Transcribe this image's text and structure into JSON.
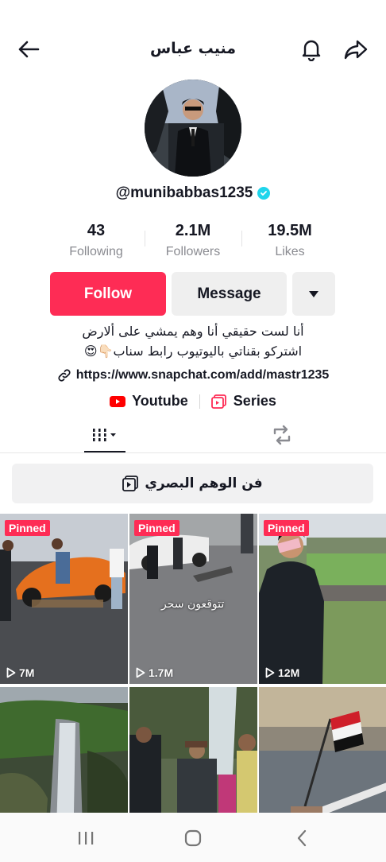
{
  "header": {
    "title": "منيب عباس",
    "back_icon": "arrow-left-icon",
    "bell_icon": "bell-icon",
    "share_icon": "share-icon"
  },
  "profile": {
    "handle": "@munibabbas1235",
    "verified": true
  },
  "stats": [
    {
      "value": "43",
      "label": "Following"
    },
    {
      "value": "2.1M",
      "label": "Followers"
    },
    {
      "value": "19.5M",
      "label": "Likes"
    }
  ],
  "actions": {
    "follow_label": "Follow",
    "message_label": "Message",
    "more_icon": "caret-down-icon"
  },
  "bio": {
    "line1": "أنا لست حقيقي أنا وهم يمشي على ألارض",
    "line2": "اشتركو بقناتي باليوتيوب رابط سناب👇🏻😍"
  },
  "link": {
    "url": "https://www.snapchat.com/add/mastr1235"
  },
  "chips": [
    {
      "label": "Youtube",
      "icon": "youtube-icon"
    },
    {
      "label": "Series",
      "icon": "series-icon"
    }
  ],
  "tabs": {
    "videos_icon": "grid-icon",
    "reposts_icon": "repost-icon"
  },
  "playlist": {
    "label": "فن الوهم البصري"
  },
  "videos": [
    {
      "pinned_label": "Pinned",
      "views": "7M"
    },
    {
      "pinned_label": "Pinned",
      "views": "1.7M",
      "caption": "تتوقعون سحر"
    },
    {
      "pinned_label": "Pinned",
      "views": "12M"
    },
    {
      "views": ""
    },
    {
      "views": ""
    },
    {
      "views": ""
    }
  ],
  "colors": {
    "accent": "#fe2c55",
    "verified": "#20d5ec",
    "youtube": "#ff0000"
  }
}
